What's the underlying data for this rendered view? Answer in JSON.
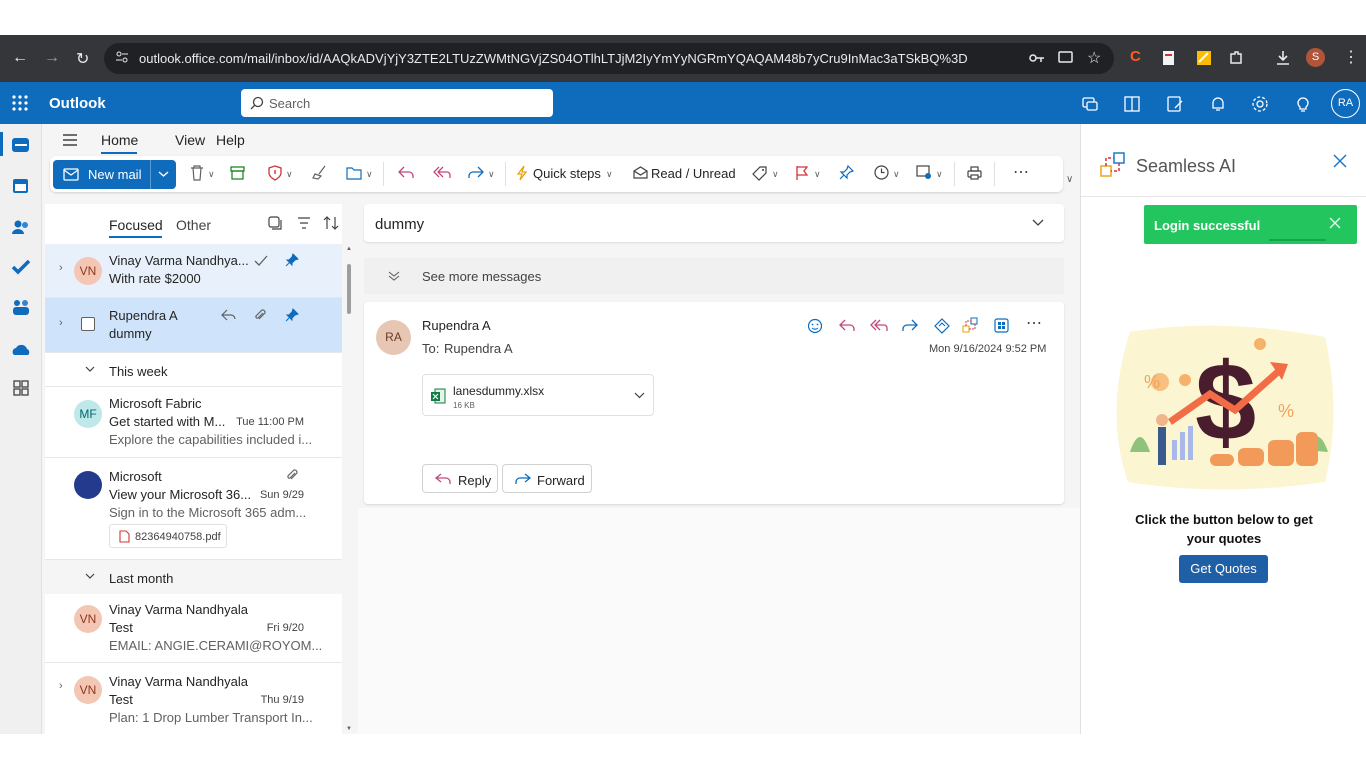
{
  "browser": {
    "url": "outlook.office.com/mail/inbox/id/AAQkADVjYjY3ZTE2LTUzZWMtNGVjZS04OTlhLTJjM2IyYmYyNGRmYQAQAM48b7yCru9InMac3aTSkBQ%3D",
    "profile_initial": "S"
  },
  "outlook": {
    "app_name": "Outlook",
    "search_placeholder": "Search",
    "user_initials": "RA"
  },
  "ribbon": {
    "tabs": [
      "Home",
      "View",
      "Help"
    ],
    "active_tab": "Home",
    "new_mail": "New mail",
    "quick_steps": "Quick steps",
    "read_unread": "Read / Unread"
  },
  "list": {
    "focused": "Focused",
    "other": "Other",
    "pinned": [
      {
        "initials": "VN",
        "sender": "Vinay Varma Nandhya...",
        "subject": "With rate $2000"
      },
      {
        "initials": "",
        "sender": "Rupendra A",
        "subject": "dummy"
      }
    ],
    "groups": {
      "this_week": "This week",
      "last_month": "Last month"
    },
    "this_week": [
      {
        "initials": "MF",
        "sender": "Microsoft Fabric",
        "subject": "Get started with M...",
        "date": "Tue 11:00 PM",
        "preview": "Explore the capabilities included i..."
      },
      {
        "initials": "",
        "sender": "Microsoft",
        "subject": "View your Microsoft 36...",
        "date": "Sun 9/29",
        "preview": "Sign in to the Microsoft 365 adm...",
        "attachment": "82364940758.pdf"
      }
    ],
    "last_month": [
      {
        "initials": "VN",
        "sender": "Vinay Varma Nandhyala",
        "subject": "Test",
        "date": "Fri 9/20",
        "preview": "EMAIL: ANGIE.CERAMI@ROYOM..."
      },
      {
        "initials": "VN",
        "sender": "Vinay Varma Nandhyala",
        "subject": "Test",
        "date": "Thu 9/19",
        "preview": "Plan: 1 Drop Lumber Transport In..."
      }
    ]
  },
  "reading": {
    "subject": "dummy",
    "see_more": "See more messages",
    "from_initials": "RA",
    "from": "Rupendra A",
    "to_label": "To:",
    "to": "Rupendra A",
    "date": "Mon 9/16/2024 9:52 PM",
    "attachment_name": "lanesdummy.xlsx",
    "attachment_size": "16 KB",
    "reply": "Reply",
    "forward": "Forward"
  },
  "addin": {
    "title": "Seamless AI",
    "toast": "Login successful",
    "prompt": "Click the button below to get your quotes",
    "button": "Get Quotes"
  },
  "colors": {
    "brand": "#0f6cbd",
    "toast": "#22c55e",
    "quote_button": "#1f5fa6"
  }
}
